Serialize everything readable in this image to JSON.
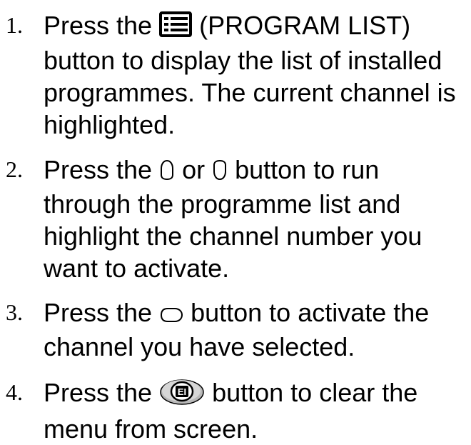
{
  "steps": [
    {
      "number": "1.",
      "before_icon": "Press the ",
      "icon": "program-list-icon",
      "after_icon": " (PROGRAM LIST) button to display the list of installed programmes. The current channel is highlighted."
    },
    {
      "number": "2.",
      "before_icon": "Press the ",
      "icon": "up-arrow-icon",
      "middle": " or ",
      "icon2": "down-arrow-icon",
      "after_icon": " button to run through the programme list and highlight the channel number you want to activate."
    },
    {
      "number": "3.",
      "before_icon": "Press the ",
      "icon": "right-arrow-icon",
      "after_icon": " button to activate the channel you have selected."
    },
    {
      "number": "4.",
      "before_icon": "Press the ",
      "icon": "exit-icon",
      "after_icon": " button to clear the menu from screen."
    }
  ]
}
